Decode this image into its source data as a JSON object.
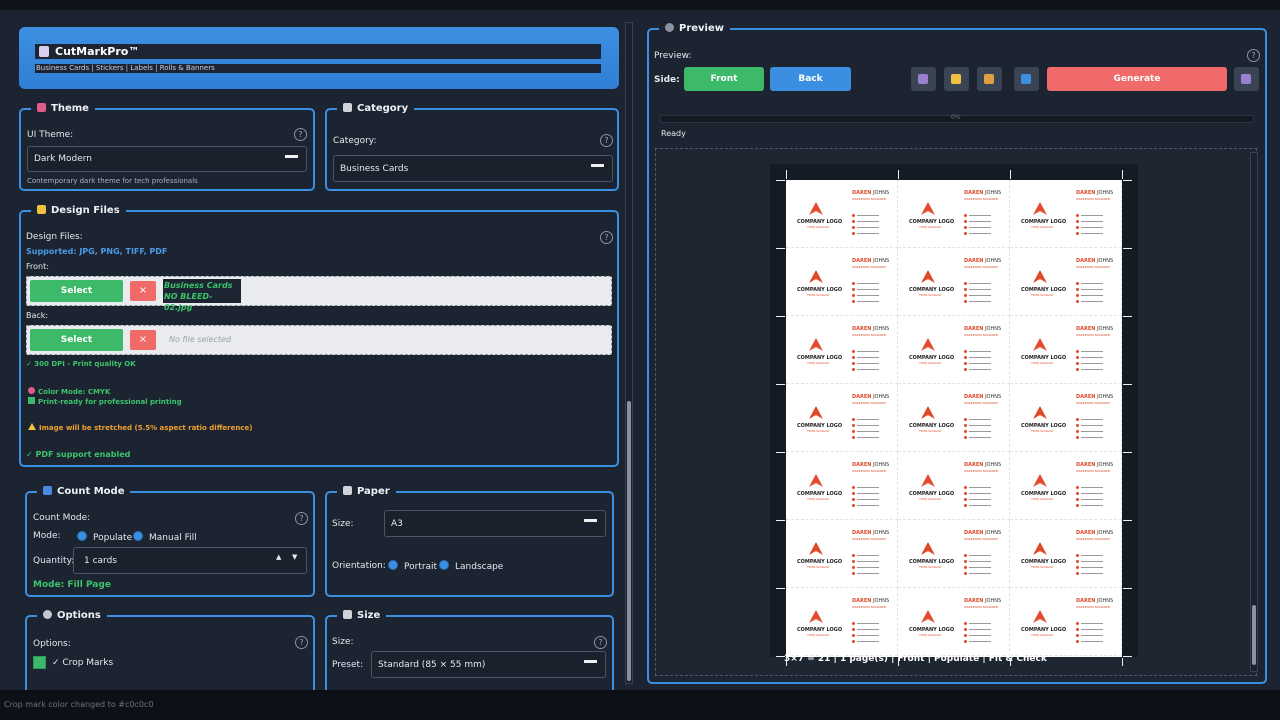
{
  "app": {
    "title": "CutMarkPro™",
    "subtitle": "Business Cards | Stickers | Labels | Rolls & Banners"
  },
  "theme": {
    "title": "Theme",
    "label": "UI Theme:",
    "value": "Dark Modern",
    "hint": "Contemporary dark theme for tech professionals"
  },
  "category": {
    "title": "Category",
    "label": "Category:",
    "value": "Business Cards"
  },
  "design_files": {
    "title": "Design Files",
    "label": "Design Files:",
    "supported": "Supported: JPG, PNG, TIFF, PDF",
    "front_label": "Front:",
    "back_label": "Back:",
    "select_label": "Select",
    "remove_label": "×",
    "front_file": "Business Cards NO BLEED-02.jpg",
    "back_placeholder": "No file selected",
    "dpi": "✓ 300 DPI - Print quality OK",
    "color_mode": "Color Mode: CMYK",
    "print_ready": "Print-ready for professional printing",
    "warning": "Image will be stretched (5.5% aspect ratio difference)",
    "pdf": "✓ PDF support enabled"
  },
  "count_mode": {
    "title": "Count Mode",
    "label": "Count Mode:",
    "mode_label": "Mode:",
    "opt_populate": "Populate",
    "opt_manual": "Manual Fill",
    "quantity_label": "Quantity:",
    "quantity_value": "1 cards",
    "mode_status": "Mode: Fill Page"
  },
  "paper": {
    "title": "Paper",
    "size_label": "Size:",
    "size_value": "A3",
    "orientation_label": "Orientation:",
    "opt_portrait": "Portrait",
    "opt_landscape": "Landscape"
  },
  "options": {
    "title": "Options",
    "label": "Options:",
    "crop_marks": "✓ Crop Marks"
  },
  "size": {
    "title": "Size",
    "label": "Size:",
    "preset_label": "Preset:",
    "preset_value": "Standard (85 × 55 mm)"
  },
  "preview": {
    "title": "Preview",
    "label": "Preview:",
    "side_label": "Side:",
    "front_btn": "Front",
    "back_btn": "Back",
    "generate_btn": "Generate",
    "status": "Ready",
    "progress_text": "0%",
    "sheet_status": "3×7 = 21 | 1 page(s) | Front | Populate | Fit & Check"
  },
  "card": {
    "logo_text": "COMPANY LOGO",
    "slogan": "YOUR SLOGAN",
    "first_name": "DAREN",
    "last_name": "JOHNS",
    "role": "MARKETING MANAGER",
    "columns": 3,
    "rows": 7
  },
  "status_bar": "Crop mark color changed to #c0c0c0",
  "colors": {
    "accent": "#3a8fe0",
    "success": "#3cba6a",
    "danger": "#f06a6a",
    "warning": "#f0a030",
    "card_accent": "#e04a2a"
  }
}
